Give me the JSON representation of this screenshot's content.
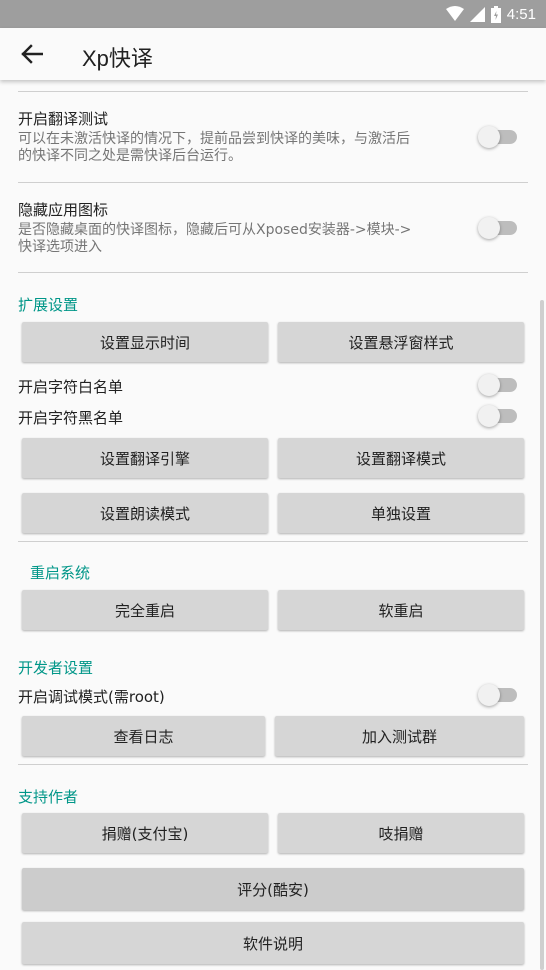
{
  "status_bar": {
    "time": "4:51",
    "icons": [
      "wifi-icon",
      "signal-icon",
      "battery-icon"
    ]
  },
  "toolbar": {
    "title": "Xp快译",
    "back_icon": "arrow-left-icon"
  },
  "prefs": {
    "translate_test": {
      "title": "开启翻译测试",
      "summary": "可以在未激活快译的情况下，提前品尝到快译的美味，与激活后的快译不同之处是需快译后台运行。",
      "enabled": false
    },
    "hide_icon": {
      "title": "隐藏应用图标",
      "summary": "是否隐藏桌面的快译图标，隐藏后可从Xposed安装器->模块->快译选项进入",
      "enabled": false
    }
  },
  "extension": {
    "header": "扩展设置",
    "set_display_time": "设置显示时间",
    "set_float_style": "设置悬浮窗样式",
    "whitelist": {
      "label": "开启字符白名单",
      "enabled": false
    },
    "blacklist": {
      "label": "开启字符黑名单",
      "enabled": false
    },
    "set_engine": "设置翻译引擎",
    "set_mode": "设置翻译模式",
    "set_read_mode": "设置朗读模式",
    "individual": "单独设置"
  },
  "reboot": {
    "header": "重启系统",
    "full": "完全重启",
    "soft": "软重启"
  },
  "developer": {
    "header": "开发者设置",
    "debug": {
      "label": "开启调试模式(需root)",
      "enabled": false
    },
    "view_log": "查看日志",
    "join_group": "加入测试群"
  },
  "support": {
    "header": "支持作者",
    "alipay": "捐赠(支付宝)",
    "donate": "吱捐赠",
    "rate": "评分(酷安)",
    "manual": "软件说明"
  },
  "colors": {
    "accent": "#009688",
    "status_bar": "#9e9e9e",
    "button": "#d6d6d6"
  }
}
